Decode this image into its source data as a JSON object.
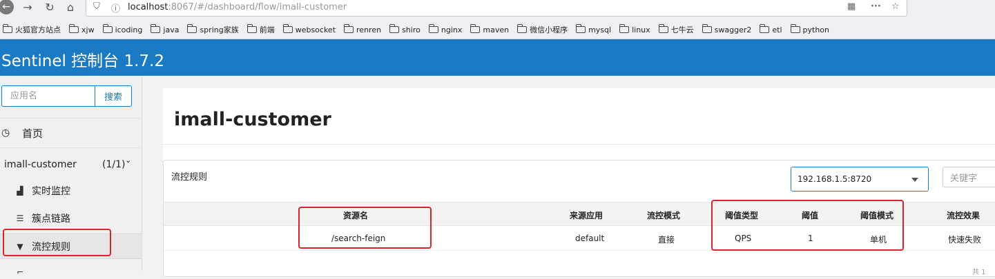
{
  "browser": {
    "url_host": "localhost",
    "url_path": ":8067/#/dashboard/flow/imall-customer",
    "bookmarks": [
      "火狐官方站点",
      "xjw",
      "icoding",
      "java",
      "spring家族",
      "前端",
      "websocket",
      "renren",
      "shiro",
      "nginx",
      "maven",
      "微信小程序",
      "mysql",
      "linux",
      "七牛云",
      "swagger2",
      "etl",
      "python"
    ]
  },
  "header": {
    "title": "Sentinel 控制台 1.7.2"
  },
  "sidebar": {
    "search": {
      "placeholder": "应用名",
      "button": "搜索"
    },
    "home": "首页",
    "app": {
      "name": "imall-customer",
      "count": "(1/1)"
    },
    "items": [
      {
        "label": "实时监控",
        "icon": "bar-chart-icon"
      },
      {
        "label": "簇点链路",
        "icon": "list-icon"
      },
      {
        "label": "流控规则",
        "icon": "filter-icon"
      }
    ]
  },
  "main": {
    "title": "imall-customer",
    "panel_title": "流控规则",
    "machine_select": "192.168.1.5:8720",
    "keyword_placeholder": "关键字",
    "columns": [
      "资源名",
      "来源应用",
      "流控模式",
      "阈值类型",
      "阈值",
      "阈值模式",
      "流控效果"
    ],
    "rows": [
      [
        "/search-feign",
        "default",
        "直接",
        "QPS",
        "1",
        "单机",
        "快速失败"
      ]
    ]
  },
  "colors": {
    "brand": "#1a7bc4",
    "highlight": "#e0202a"
  }
}
